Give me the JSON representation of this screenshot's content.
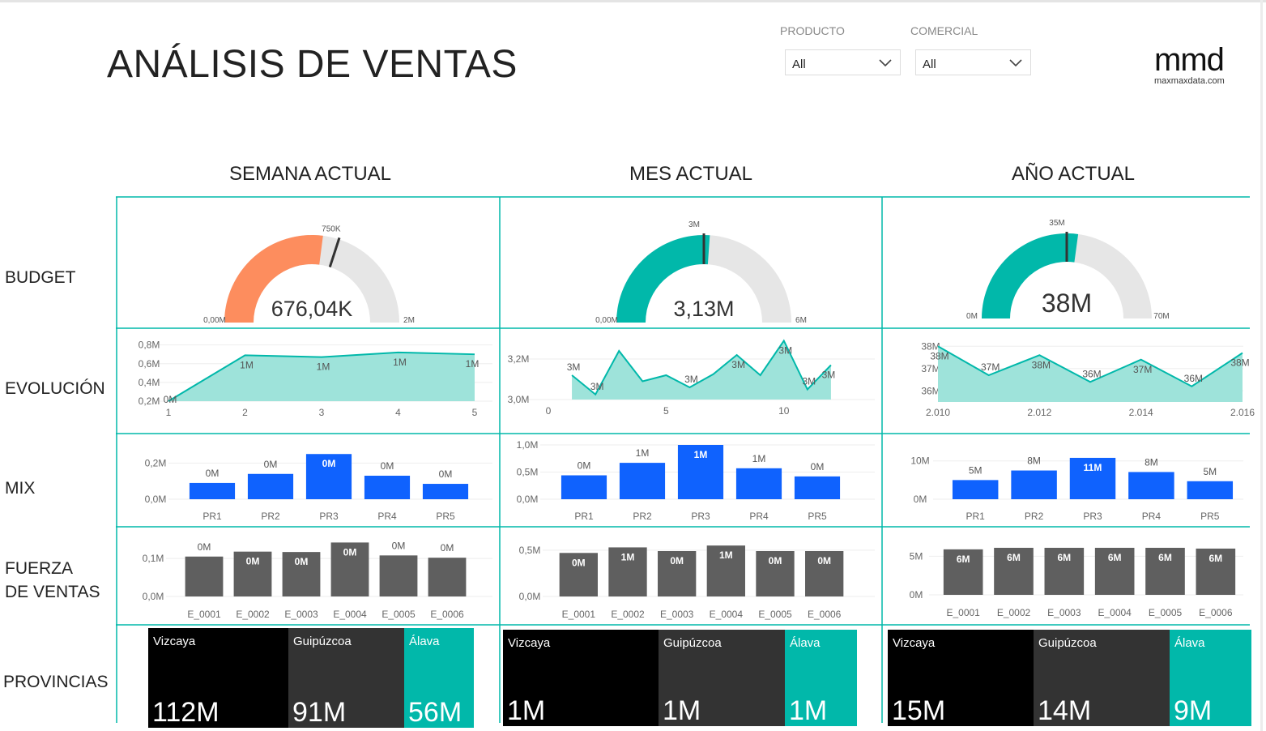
{
  "header": {
    "title": "ANÁLISIS DE VENTAS",
    "filters": [
      {
        "label": "PRODUCTO",
        "value": "All"
      },
      {
        "label": "COMERCIAL",
        "value": "All"
      }
    ],
    "logo": {
      "text": "mmd",
      "subtext": "maxmaxdata.com"
    }
  },
  "columns": [
    "SEMANA ACTUAL",
    "MES ACTUAL",
    "AÑO ACTUAL"
  ],
  "rows": [
    "BUDGET",
    "EVOLUCIÓN",
    "MIX",
    "FUERZA\nDE VENTAS",
    "PROVINCIAS"
  ],
  "colors": {
    "accent": "#01b8aa",
    "area": "#9ee3da",
    "warning": "#fd8d5e",
    "bar_blue": "#0f62fe",
    "bar_gray": "#5f5f5f",
    "gauge_bg": "#e6e6e6",
    "tile_black": "#000000",
    "tile_dark": "#333333"
  },
  "chart_data": [
    {
      "type": "gauge",
      "column": "SEMANA ACTUAL",
      "value": 676040,
      "value_label": "676,04K",
      "min_label": "0,00M",
      "max_label": "2M",
      "min": 0,
      "max": 1250000,
      "target": 750000,
      "target_label": "750K",
      "color": "#fd8d5e"
    },
    {
      "type": "gauge",
      "column": "MES ACTUAL",
      "value": 3130000,
      "value_label": "3,13M",
      "min_label": "0,00M",
      "max_label": "6M",
      "min": 0,
      "max": 6000000,
      "target": 3000000,
      "target_label": "3M",
      "color": "#01b8aa"
    },
    {
      "type": "gauge",
      "column": "AÑO ACTUAL",
      "value": 38000000,
      "value_label": "38M",
      "min_label": "0M",
      "max_label": "70M",
      "min": 0,
      "max": 70000000,
      "target": 35000000,
      "target_label": "35M",
      "color": "#01b8aa"
    },
    {
      "type": "area",
      "column": "SEMANA ACTUAL",
      "x": [
        1,
        2,
        3,
        4,
        5
      ],
      "values": [
        0.2,
        0.69,
        0.67,
        0.72,
        0.7
      ],
      "labels": [
        "0M",
        "1M",
        "1M",
        "1M",
        "1M"
      ],
      "xticks": [
        "1",
        "2",
        "3",
        "4",
        "5"
      ],
      "yticks": [
        "0,2M",
        "0,4M",
        "0,6M",
        "0,8M"
      ],
      "ytick_values": [
        0.2,
        0.4,
        0.6,
        0.8
      ],
      "ylim": [
        0.2,
        0.84
      ],
      "xlim": [
        1,
        5
      ]
    },
    {
      "type": "area",
      "column": "MES ACTUAL",
      "x": [
        1,
        2,
        3,
        4,
        5,
        6,
        7,
        8,
        9,
        10,
        11,
        12
      ],
      "values": [
        3.12,
        3.025,
        3.24,
        3.09,
        3.12,
        3.06,
        3.125,
        3.22,
        3.12,
        3.29,
        3.05,
        3.17
      ],
      "labels": [
        "3M",
        "3M",
        "",
        "",
        "",
        "3M",
        "",
        "3M",
        "",
        "3M",
        "3M",
        "3M"
      ],
      "xticks": [
        "0",
        "5",
        "10"
      ],
      "xtick_values": [
        0,
        5,
        10
      ],
      "yticks": [
        "3,0M",
        "3,2M"
      ],
      "ytick_values": [
        3.0,
        3.2
      ],
      "ylim": [
        3.0,
        3.3
      ],
      "xlim": [
        0,
        13
      ]
    },
    {
      "type": "area",
      "column": "AÑO ACTUAL",
      "x": [
        2010,
        2011,
        2012,
        2013,
        2014,
        2015,
        2016
      ],
      "values": [
        38,
        36.7,
        37.6,
        36.4,
        37.4,
        36.2,
        37.7
      ],
      "labels": [
        "38M",
        "37M",
        "38M",
        "36M",
        "37M",
        "36M",
        "38M"
      ],
      "xticks": [
        "2.010",
        "2.012",
        "2.014",
        "2.016"
      ],
      "xtick_values": [
        2010,
        2012,
        2014,
        2016
      ],
      "yticks": [
        "36M",
        "37M",
        "38M"
      ],
      "ytick_values": [
        36,
        37,
        38
      ],
      "ylim": [
        35.5,
        38.3
      ],
      "xlim": [
        2010,
        2016
      ]
    },
    {
      "type": "bar",
      "column": "SEMANA ACTUAL",
      "categories": [
        "PR1",
        "PR2",
        "PR3",
        "PR4",
        "PR5"
      ],
      "values": [
        0.09,
        0.14,
        0.25,
        0.13,
        0.085
      ],
      "labels": [
        "0M",
        "0M",
        "0M",
        "0M",
        "0M"
      ],
      "yticks": [
        "0,0M",
        "0,2M"
      ],
      "ytick_values": [
        0,
        0.2
      ],
      "ylim": [
        0,
        0.26
      ],
      "highlight": 2
    },
    {
      "type": "bar",
      "column": "MES ACTUAL",
      "categories": [
        "PR1",
        "PR2",
        "PR3",
        "PR4",
        "PR5"
      ],
      "values": [
        0.44,
        0.67,
        1.0,
        0.57,
        0.42
      ],
      "labels": [
        "0M",
        "1M",
        "1M",
        "1M",
        "0M"
      ],
      "yticks": [
        "0,0M",
        "0,5M",
        "1,0M"
      ],
      "ytick_values": [
        0,
        0.5,
        1.0
      ],
      "ylim": [
        0,
        1.0
      ],
      "highlight": 2
    },
    {
      "type": "bar",
      "column": "AÑO ACTUAL",
      "categories": [
        "PR1",
        "PR2",
        "PR3",
        "PR4",
        "PR5"
      ],
      "values": [
        5,
        7.5,
        10.8,
        7.1,
        4.7
      ],
      "labels": [
        "5M",
        "8M",
        "11M",
        "8M",
        "5M"
      ],
      "yticks": [
        "0M",
        "10M"
      ],
      "ytick_values": [
        0,
        10
      ],
      "ylim": [
        0,
        11
      ],
      "highlight": 2
    },
    {
      "type": "bar",
      "column": "SEMANA ACTUAL",
      "categories": [
        "E_0001",
        "E_0002",
        "E_0003",
        "E_0004",
        "E_0005",
        "E_0006"
      ],
      "values": [
        0.105,
        0.118,
        0.117,
        0.142,
        0.108,
        0.102
      ],
      "labels": [
        "0M",
        "0M",
        "0M",
        "0M",
        "0M",
        "0M"
      ],
      "yticks": [
        "0,0M",
        "0,1M"
      ],
      "ytick_values": [
        0,
        0.1
      ],
      "ylim": [
        0,
        0.145
      ]
    },
    {
      "type": "bar",
      "column": "MES ACTUAL",
      "categories": [
        "E_0001",
        "E_0002",
        "E_0003",
        "E_0004",
        "E_0005",
        "E_0006"
      ],
      "values": [
        0.47,
        0.53,
        0.49,
        0.55,
        0.49,
        0.49
      ],
      "labels": [
        "0M",
        "1M",
        "0M",
        "1M",
        "0M",
        "0M"
      ],
      "yticks": [
        "0,0M",
        "0,5M"
      ],
      "ytick_values": [
        0,
        0.5
      ],
      "ylim": [
        0,
        0.56
      ]
    },
    {
      "type": "bar",
      "column": "AÑO ACTUAL",
      "categories": [
        "E_0001",
        "E_0002",
        "E_0003",
        "E_0004",
        "E_0005",
        "E_0006"
      ],
      "values": [
        5.9,
        6.1,
        6.1,
        6.1,
        6.1,
        6.0
      ],
      "labels": [
        "6M",
        "6M",
        "6M",
        "6M",
        "6M",
        "6M"
      ],
      "yticks": [
        "0M",
        "5M"
      ],
      "ytick_values": [
        0,
        5
      ],
      "ylim": [
        0,
        6.2
      ]
    }
  ],
  "provincias": [
    {
      "column": "SEMANA ACTUAL",
      "tiles": [
        {
          "name": "Vizcaya",
          "value": "112M"
        },
        {
          "name": "Guipúzcoa",
          "value": "91M"
        },
        {
          "name": "Álava",
          "value": "56M"
        }
      ]
    },
    {
      "column": "MES ACTUAL",
      "tiles": [
        {
          "name": "Vizcaya",
          "value": "1M"
        },
        {
          "name": "Guipúzcoa",
          "value": "1M"
        },
        {
          "name": "Álava",
          "value": "1M"
        }
      ]
    },
    {
      "column": "AÑO ACTUAL",
      "tiles": [
        {
          "name": "Vizcaya",
          "value": "15M"
        },
        {
          "name": "Guipúzcoa",
          "value": "14M"
        },
        {
          "name": "Álava",
          "value": "9M"
        }
      ]
    }
  ]
}
